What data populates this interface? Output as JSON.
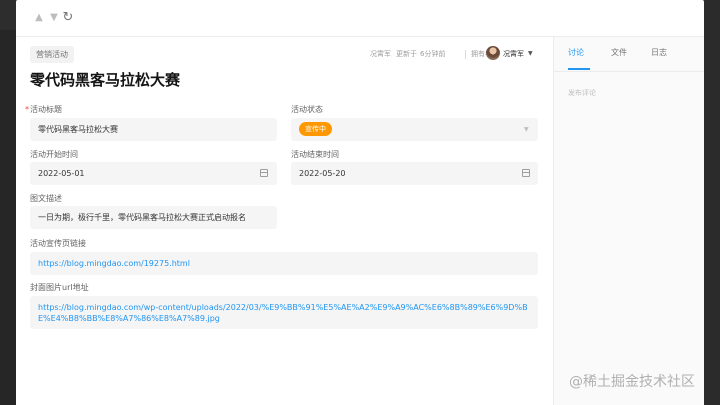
{
  "nav": {
    "back_icon": "chevron-up-icon",
    "forward_icon": "chevron-down-icon",
    "refresh_icon": "refresh-icon"
  },
  "record": {
    "category_tag": "营销活动",
    "title": "零代码黑客马拉松大赛",
    "updated_by": "况霄军",
    "updated_text": "更新于",
    "updated_time": "6分钟前",
    "owner_label": "拥有者:",
    "owner_name": "况霄军"
  },
  "fields": {
    "activity_title": {
      "label": "活动标题",
      "value": "零代码黑客马拉松大赛"
    },
    "activity_status": {
      "label": "活动状态",
      "value": "宣传中"
    },
    "start_date": {
      "label": "活动开始时间",
      "value": "2022-05-01"
    },
    "end_date": {
      "label": "活动结束时间",
      "value": "2022-05-20"
    },
    "description": {
      "label": "图文描述",
      "value": "一日为期，极行千里，零代码黑客马拉松大赛正式启动报名"
    },
    "promo_link": {
      "label": "活动宣传页链接",
      "value": "https://blog.mingdao.com/19275.html"
    },
    "cover_url": {
      "label": "封面图片url地址",
      "value": "https://blog.mingdao.com/wp-content/uploads/2022/03/%E9%BB%91%E5%AE%A2%E9%A9%AC%E6%8B%89%E6%9D%BE%E4%B8%BB%E8%A7%86%E8%A7%89.jpg"
    }
  },
  "side": {
    "tabs": [
      "讨论",
      "文件",
      "日志"
    ],
    "comment_placeholder": "发布评论"
  },
  "watermark": "@稀土掘金技术社区",
  "colors": {
    "accent": "#2196f3",
    "status": "#ff9800"
  }
}
